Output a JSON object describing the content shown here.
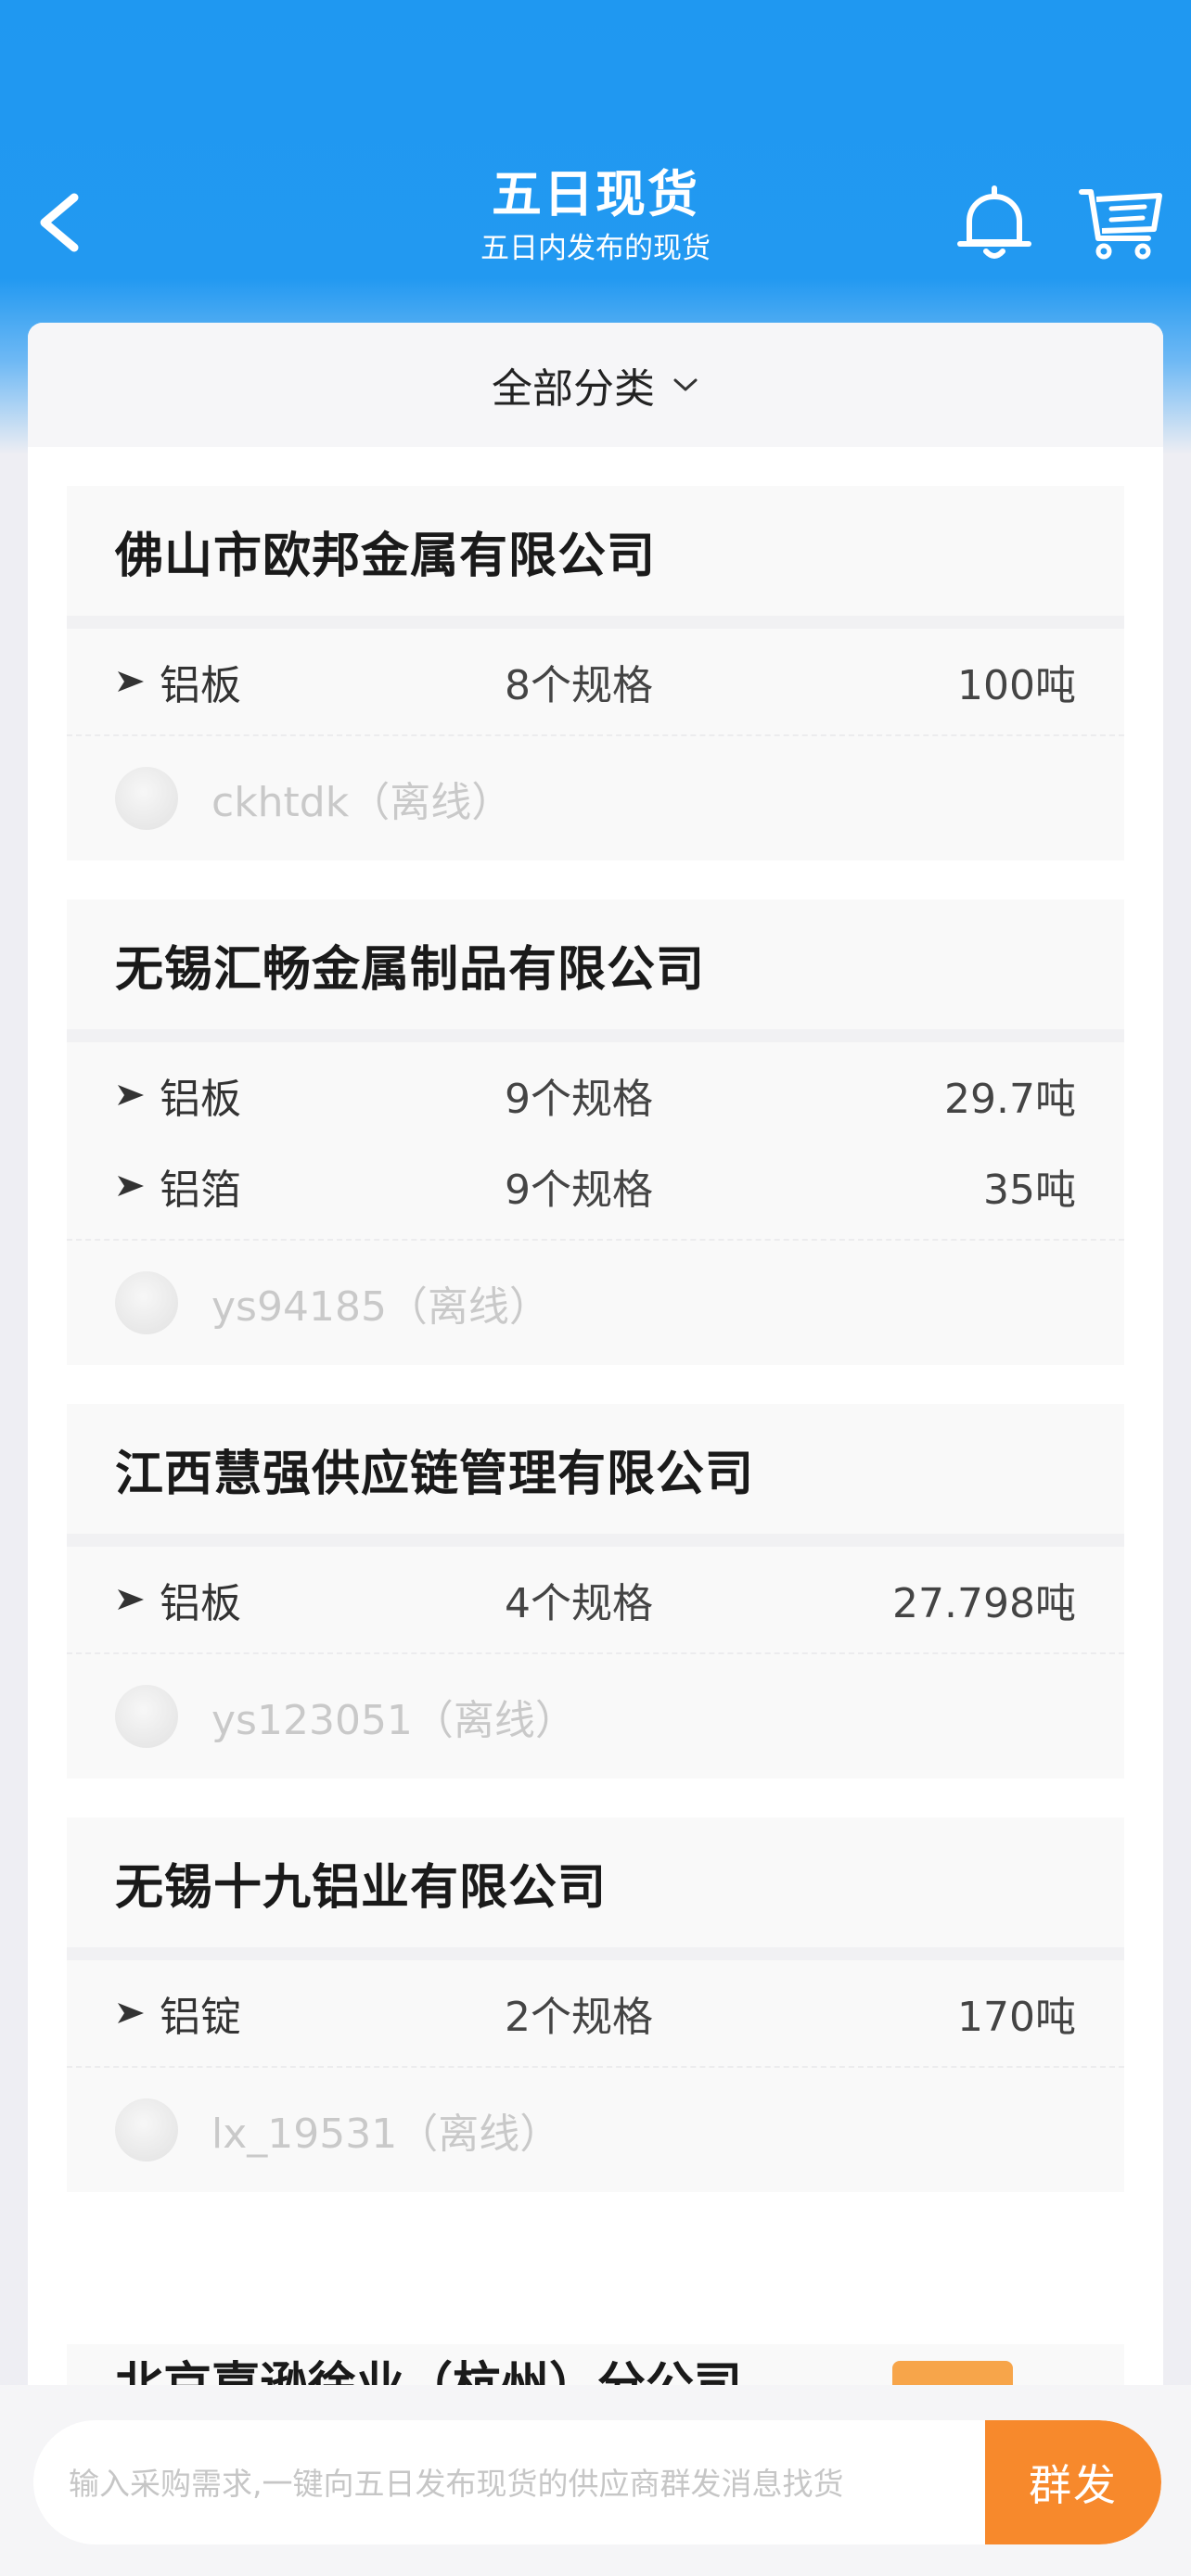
{
  "header": {
    "title": "五日现货",
    "subtitle": "五日内发布的现货",
    "back_icon": "chevron-left-icon",
    "bell_icon": "bell-icon",
    "cart_icon": "cart-icon"
  },
  "filter": {
    "label": "全部分类"
  },
  "suppliers": [
    {
      "company": "佛山市欧邦金属有限公司",
      "products": [
        {
          "name": "铝板",
          "specs": "8个规格",
          "qty": "100吨"
        }
      ],
      "user": "ckhtdk（离线）"
    },
    {
      "company": "无锡汇畅金属制品有限公司",
      "products": [
        {
          "name": "铝板",
          "specs": "9个规格",
          "qty": "29.7吨"
        },
        {
          "name": "铝箔",
          "specs": "9个规格",
          "qty": "35吨"
        }
      ],
      "user": "ys94185（离线）"
    },
    {
      "company": "江西慧强供应链管理有限公司",
      "products": [
        {
          "name": "铝板",
          "specs": "4个规格",
          "qty": "27.798吨"
        }
      ],
      "user": "ys123051（离线）"
    },
    {
      "company": "无锡十九铝业有限公司",
      "products": [
        {
          "name": "铝锭",
          "specs": "2个规格",
          "qty": "170吨"
        }
      ],
      "user": "lx_19531（离线）"
    }
  ],
  "partial_company": "北京嘉逊徐业（杭州）分公司",
  "bottom": {
    "placeholder": "输入采购需求,一键向五日发布现货的供应商群发消息找货",
    "send_label": "群发"
  },
  "colors": {
    "header_blue": "#1f98f1",
    "send_orange": "#f7892c"
  }
}
